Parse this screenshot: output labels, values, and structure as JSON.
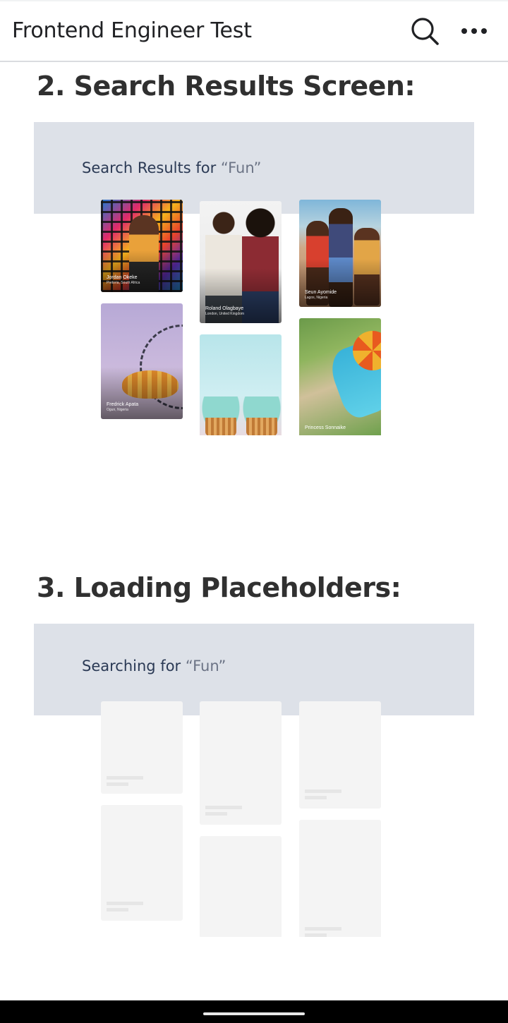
{
  "appbar": {
    "title": "Frontend Engineer Test",
    "search_icon": "search-icon",
    "more_icon": "more-horizontal-icon"
  },
  "section2": {
    "heading": "2. Search Results Screen:",
    "banner_prefix": "Search Results for ",
    "banner_query": "“Fun”",
    "cards": [
      {
        "name": "Jordan Okeke",
        "location": "Pretoria, South Africa"
      },
      {
        "name": "Roland Olagbaye",
        "location": "London, United Kingdom"
      },
      {
        "name": "Seun Ayomide",
        "location": "Lagos, Nigeria"
      },
      {
        "name": "Fredrick Apata",
        "location": "Ogun, Nigeria"
      },
      {
        "name": "",
        "location": ""
      },
      {
        "name": "Princess Sonnaike",
        "location": ""
      }
    ]
  },
  "section3": {
    "heading": "3. Loading Placeholders:",
    "banner_prefix": "Searching for ",
    "banner_query": "“Fun”"
  },
  "colors": {
    "banner": "#dde1e8",
    "banner_text": "#2b3a55",
    "skeleton": "#f4f4f4",
    "heading": "#303030"
  }
}
